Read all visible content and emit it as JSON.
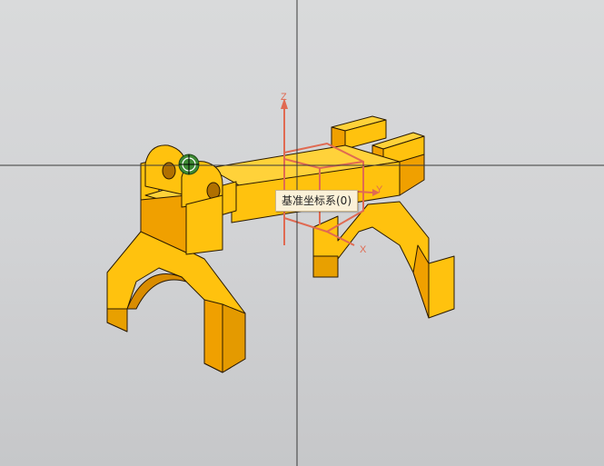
{
  "viewport": {
    "background_top": "#d9dadb",
    "background_bottom": "#c6c7c9",
    "crosshair_color": "#3a3a3a"
  },
  "model": {
    "face_color": "#ffc20e",
    "side_color": "#f0a000",
    "dark_color": "#d98c00",
    "edge_color": "#2a1a00"
  },
  "datum_csys": {
    "color": "#e06a52",
    "axes": {
      "z": "Z",
      "y": "Y",
      "x": "X"
    }
  },
  "tooltip": {
    "text": "基准坐标系(0)"
  },
  "cursor": {
    "icon": "snap-cursor-icon",
    "color": "#2f7a2a"
  }
}
